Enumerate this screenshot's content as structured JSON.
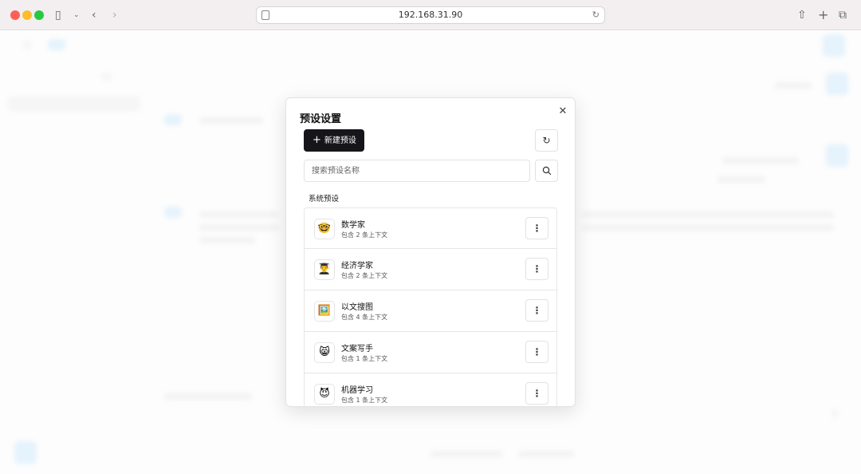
{
  "browser": {
    "url": "192.168.31.90"
  },
  "modal": {
    "title": "预设设置",
    "new_button_label": "新建预设",
    "search_placeholder": "搜索预设名称",
    "section_label": "系统预设",
    "presets": [
      {
        "emoji": "🤓",
        "name": "数学家",
        "context": "包含 2 条上下文"
      },
      {
        "emoji": "👨‍🎓",
        "name": "经济学家",
        "context": "包含 2 条上下文"
      },
      {
        "emoji": "🖼️",
        "name": "以文搜图",
        "context": "包含 4 条上下文"
      },
      {
        "emoji": "😸",
        "name": "文案写手",
        "context": "包含 1 条上下文"
      },
      {
        "emoji": "😈",
        "name": "机器学习",
        "context": "包含 1 条上下文"
      }
    ]
  }
}
